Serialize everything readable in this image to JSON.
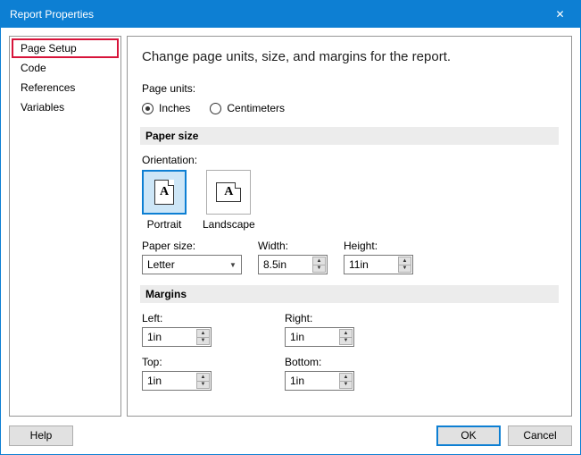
{
  "title": "Report Properties",
  "sidebar": {
    "items": [
      {
        "label": "Page Setup",
        "selected": true
      },
      {
        "label": "Code",
        "selected": false
      },
      {
        "label": "References",
        "selected": false
      },
      {
        "label": "Variables",
        "selected": false
      }
    ]
  },
  "main": {
    "heading": "Change page units, size, and margins for the report.",
    "page_units_label": "Page units:",
    "units": {
      "inches": "Inches",
      "centimeters": "Centimeters",
      "selected": "inches"
    },
    "paper_size_header": "Paper size",
    "orientation_label": "Orientation:",
    "orientation": {
      "portrait": "Portrait",
      "landscape": "Landscape",
      "selected": "portrait"
    },
    "paper_size_label": "Paper size:",
    "paper_size_value": "Letter",
    "width_label": "Width:",
    "width_value": "8.5in",
    "height_label": "Height:",
    "height_value": "11in",
    "margins_header": "Margins",
    "margins": {
      "left_label": "Left:",
      "left": "1in",
      "right_label": "Right:",
      "right": "1in",
      "top_label": "Top:",
      "top": "1in",
      "bottom_label": "Bottom:",
      "bottom": "1in"
    }
  },
  "buttons": {
    "help": "Help",
    "ok": "OK",
    "cancel": "Cancel"
  }
}
